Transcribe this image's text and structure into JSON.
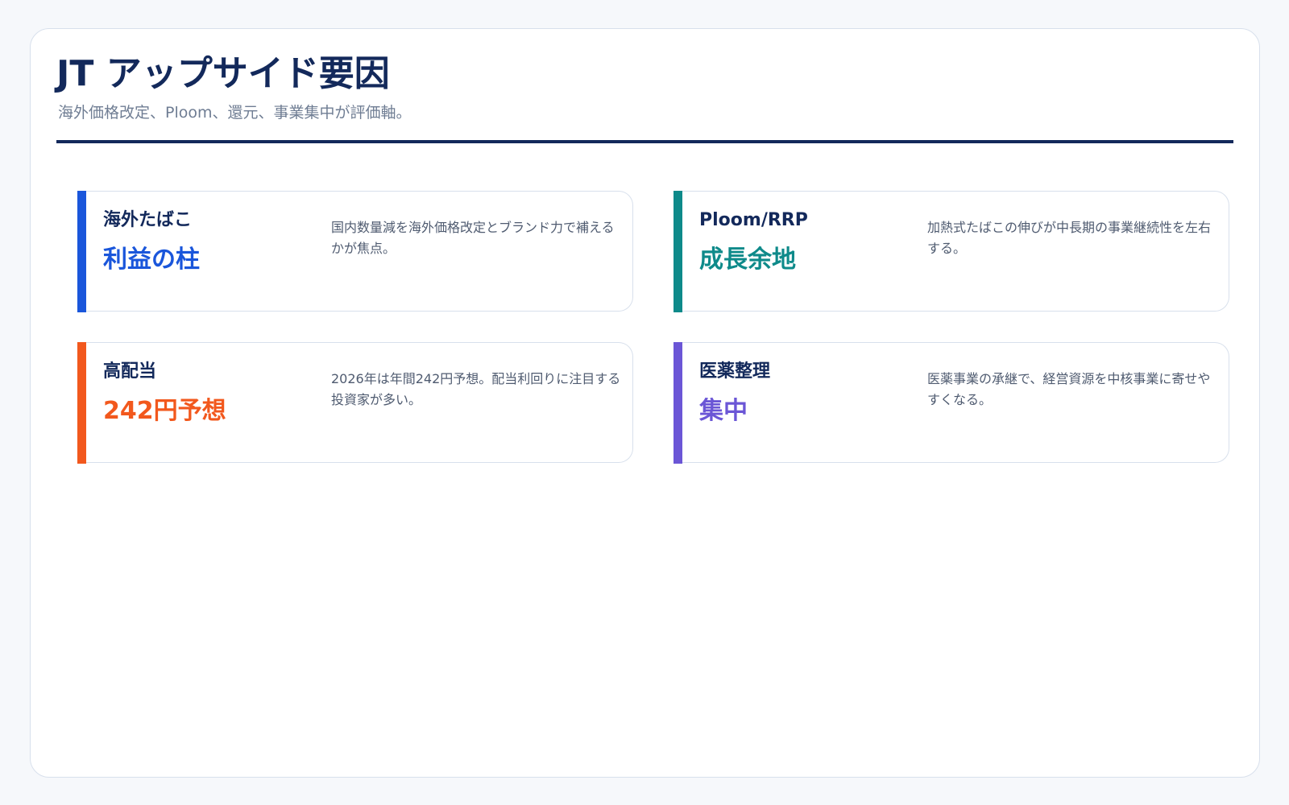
{
  "header": {
    "title": "JT アップサイド要因",
    "subtitle": "海外価格改定、Ploom、還元、事業集中が評価軸。"
  },
  "colors": {
    "heading": "#13295b",
    "blue": "#1a56db",
    "teal": "#0e8a8a",
    "orange": "#f2581d",
    "purple": "#6b56d6"
  },
  "cards": [
    {
      "label": "海外たばこ",
      "value": "利益の柱",
      "description": "国内数量減を海外価格改定とブランド力で補えるかが焦点。",
      "accent_color": "#1a56db"
    },
    {
      "label": "Ploom/RRP",
      "value": "成長余地",
      "description": "加熱式たばこの伸びが中長期の事業継続性を左右する。",
      "accent_color": "#0e8a8a"
    },
    {
      "label": "高配当",
      "value": "242円予想",
      "description": "2026年は年間242円予想。配当利回りに注目する投資家が多い。",
      "accent_color": "#f2581d"
    },
    {
      "label": "医薬整理",
      "value": "集中",
      "description": "医薬事業の承継で、経営資源を中核事業に寄せやすくなる。",
      "accent_color": "#6b56d6"
    }
  ]
}
